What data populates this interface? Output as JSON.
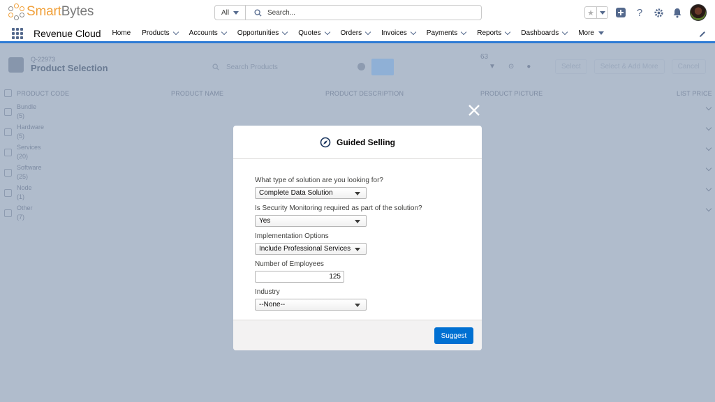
{
  "brand": {
    "name_part1": "Smart",
    "name_part2": "Bytes"
  },
  "search": {
    "scope": "All",
    "placeholder": "Search..."
  },
  "nav": {
    "app_name": "Revenue Cloud",
    "items": [
      "Home",
      "Products",
      "Accounts",
      "Opportunities",
      "Quotes",
      "Orders",
      "Invoices",
      "Payments",
      "Reports",
      "Dashboards",
      "More"
    ]
  },
  "page": {
    "record_id": "Q-22973",
    "title": "Product Selection",
    "search_placeholder": "Search Products",
    "result_count": "63",
    "buttons": [
      "Select",
      "Select & Add More",
      "Cancel"
    ],
    "columns": [
      "PRODUCT CODE",
      "PRODUCT NAME",
      "PRODUCT DESCRIPTION",
      "PRODUCT PICTURE",
      "LIST PRICE"
    ],
    "rows": [
      {
        "name": "Bundle",
        "count": "(5)"
      },
      {
        "name": "Hardware",
        "count": "(5)"
      },
      {
        "name": "Services",
        "count": "(20)"
      },
      {
        "name": "Software",
        "count": "(25)"
      },
      {
        "name": "Node",
        "count": "(1)"
      },
      {
        "name": "Other",
        "count": "(7)"
      }
    ]
  },
  "modal": {
    "title": "Guided Selling",
    "questions": [
      {
        "label": "What type of solution are you looking for?",
        "value": "Complete Data Solution"
      },
      {
        "label": "Is Security Monitoring required as part of the solution?",
        "value": "Yes"
      },
      {
        "label": "Implementation Options",
        "value": "Include Professional Services"
      },
      {
        "label": "Number of Employees",
        "value": "125"
      },
      {
        "label": "Industry",
        "value": "--None--"
      }
    ],
    "suggest_label": "Suggest"
  },
  "colors": {
    "accent": "#0070d2",
    "nav_underline": "#2e7bd5",
    "overlay": "#b0bccc"
  }
}
